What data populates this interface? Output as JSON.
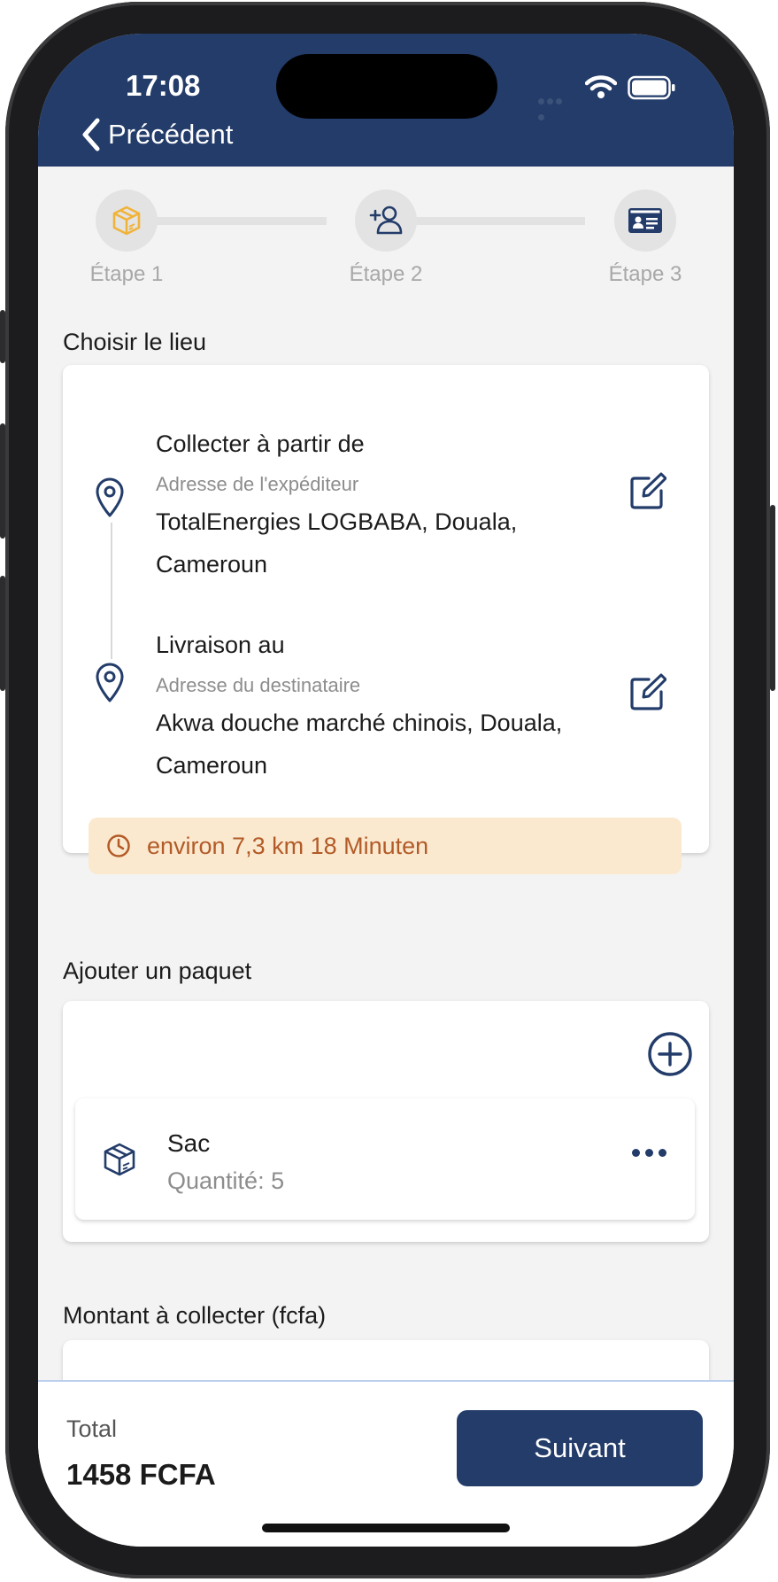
{
  "status_bar": {
    "time": "17:08"
  },
  "nav": {
    "back_label": "Précédent"
  },
  "stepper": {
    "steps": [
      {
        "label": "Étape 1",
        "icon": "package-icon",
        "color": "#f0b33a"
      },
      {
        "label": "Étape 2",
        "icon": "add-person-icon",
        "color": "#233c6a"
      },
      {
        "label": "Étape 3",
        "icon": "id-card-icon",
        "color": "#233c6a"
      }
    ]
  },
  "location": {
    "section_title": "Choisir le lieu",
    "pickup": {
      "title": "Collecter à partir de",
      "subtitle": "Adresse de l'expéditeur",
      "value": "TotalEnergies LOGBABA, Douala, Cameroun"
    },
    "delivery": {
      "title": "Livraison au",
      "subtitle": "Adresse du destinataire",
      "value": "Akwa douche marché chinois, Douala, Cameroun"
    },
    "eta": "environ 7,3 km 18 Minuten"
  },
  "packages": {
    "section_title": "Ajouter un paquet",
    "items": [
      {
        "name": "Sac",
        "quantity": "Quantité: 5"
      }
    ]
  },
  "amount": {
    "section_title": "Montant à collecter (fcfa)"
  },
  "footer": {
    "total_label": "Total",
    "total_value": "1458 FCFA",
    "next_label": "Suivant"
  },
  "colors": {
    "primary": "#233c6a",
    "accent": "#f0b33a",
    "eta_bg": "#fbe9cf",
    "eta_text": "#b25b28"
  }
}
